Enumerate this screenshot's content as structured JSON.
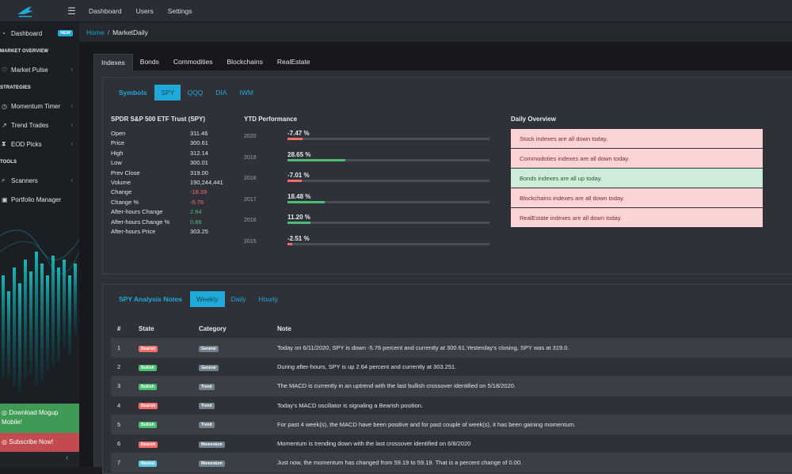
{
  "topnav": {
    "items": [
      "Dashboard",
      "Users",
      "Settings"
    ]
  },
  "sidebar": {
    "dashboard": {
      "label": "Dashboard",
      "badge": "NEW"
    },
    "market_overview_header": "MARKET OVERVIEW",
    "market_pulse": "Market Pulse",
    "strategies_header": "STRATEGIES",
    "momentum_timer": "Momentum Timer",
    "trend_trades": "Trend Trades",
    "eod_picks": "EOD Picks",
    "tools_header": "TOOLS",
    "scanners": "Scanners",
    "portfolio_manager": "Portfolio Manager",
    "download": "Download Mogup Mobile!",
    "subscribe": "Subscribe Now!"
  },
  "breadcrumb": {
    "home": "Home",
    "separator": "/",
    "current": "MarketDaily"
  },
  "tabs": [
    "Indexes",
    "Bonds",
    "Commodities",
    "Blockchains",
    "RealEstate"
  ],
  "symbols": {
    "label": "Symbols",
    "items": [
      "SPY",
      "QQQ",
      "DIA",
      "IWM"
    ],
    "active": "SPY"
  },
  "stock": {
    "title": "SPDR S&P 500 ETF Trust (SPY)",
    "stats": [
      {
        "key": "Open",
        "value": "311.46",
        "tone": ""
      },
      {
        "key": "Price",
        "value": "300.61",
        "tone": ""
      },
      {
        "key": "High",
        "value": "312.14",
        "tone": ""
      },
      {
        "key": "Low",
        "value": "300.01",
        "tone": ""
      },
      {
        "key": "Prev Close",
        "value": "319.00",
        "tone": ""
      },
      {
        "key": "Volume",
        "value": "190,244,441",
        "tone": ""
      },
      {
        "key": "Change",
        "value": "-18.39",
        "tone": "neg"
      },
      {
        "key": "Change %",
        "value": "-5.76",
        "tone": "neg"
      },
      {
        "key": "After-hours Change",
        "value": "2.64",
        "tone": "pos"
      },
      {
        "key": "After-hours Change %",
        "value": "0.88",
        "tone": "pos"
      },
      {
        "key": "After-hours Price",
        "value": "303.25",
        "tone": ""
      }
    ]
  },
  "ytd": {
    "title": "YTD Performance",
    "rows": [
      {
        "year": "2020",
        "pct": "-7.47 %",
        "value": -7.47
      },
      {
        "year": "2019",
        "pct": "28.65 %",
        "value": 28.65
      },
      {
        "year": "2018",
        "pct": "-7.01 %",
        "value": -7.01
      },
      {
        "year": "2017",
        "pct": "18.48 %",
        "value": 18.48
      },
      {
        "year": "2016",
        "pct": "11.20 %",
        "value": 11.2
      },
      {
        "year": "2015",
        "pct": "-2.51 %",
        "value": -2.51
      }
    ],
    "colors": {
      "pos": "#4dbd74",
      "neg": "#f86c6b"
    }
  },
  "daily_overview": {
    "title": "Daily Overview",
    "items": [
      {
        "text": "Stock indexes are all down today.",
        "tone": "down"
      },
      {
        "text": "Commodoties indexes are all down today.",
        "tone": "down"
      },
      {
        "text": "Bonds indexes are all up today.",
        "tone": "up"
      },
      {
        "text": "Blockchains indexes are all down today.",
        "tone": "down"
      },
      {
        "text": "RealEstate indexes are all down today.",
        "tone": "down"
      }
    ]
  },
  "notes": {
    "label": "SPY Analysis Notes",
    "periods": [
      "Weekly",
      "Daily",
      "Hourly"
    ],
    "active": "Weekly",
    "headers": [
      "#",
      "State",
      "Category",
      "Note"
    ],
    "rows": [
      {
        "num": "1",
        "state": "Bearish",
        "category": "General",
        "note": "Today on 6/11/2020, SPY is down -5.76 percent and currently at 300.61.Yesterday's closing, SPY was at 319.0."
      },
      {
        "num": "2",
        "state": "Bullish",
        "category": "General",
        "note": "During after-hours, SPY is up 2.64 percent and currently at 303.251."
      },
      {
        "num": "3",
        "state": "Bullish",
        "category": "Trend",
        "note": "The MACD is currently in an uptrend with the last bullish crossover identified on 5/18/2020."
      },
      {
        "num": "4",
        "state": "Bearish",
        "category": "Trend",
        "note": "Today's MACD oscillator is signaling a Bearish position."
      },
      {
        "num": "5",
        "state": "Bullish",
        "category": "Trend",
        "note": "For past 4 week(s), the MACD have been positive and for past couple of week(s), it has been gaining momentum."
      },
      {
        "num": "6",
        "state": "Bearish",
        "category": "Momentum",
        "note": "Momentum is trending down with the last crossover identified on 6/8/2020"
      },
      {
        "num": "7",
        "state": "Neutral",
        "category": "Momentum",
        "note": "Just now, the momentum has changed from 59.19 to 59.19. That is a percent change of 0.00."
      }
    ]
  }
}
